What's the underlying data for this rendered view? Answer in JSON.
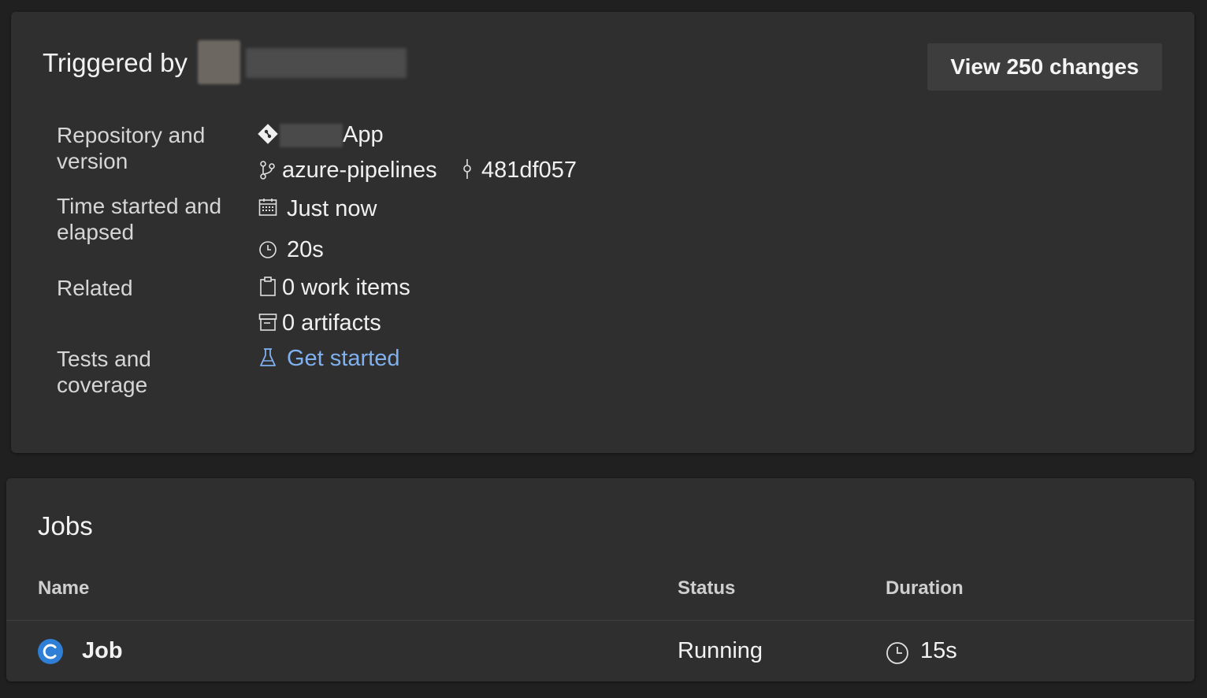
{
  "summary": {
    "triggered_by_label": "Triggered by",
    "view_changes_label": "View 250 changes",
    "repository": {
      "label": "Repository and version",
      "repo_name_suffix": "App",
      "branch": "azure-pipelines",
      "commit": "481df057"
    },
    "time": {
      "label": "Time started and elapsed",
      "started": "Just now",
      "elapsed": "20s"
    },
    "related": {
      "label": "Related",
      "work_items": "0 work items",
      "artifacts": "0 artifacts"
    },
    "tests": {
      "label": "Tests and coverage",
      "link": "Get started"
    }
  },
  "jobs": {
    "title": "Jobs",
    "columns": [
      "Name",
      "Status",
      "Duration"
    ],
    "rows": [
      {
        "name": "Job",
        "status": "Running",
        "duration": "15s"
      }
    ]
  },
  "icons": {
    "repo": "git-repo-icon",
    "branch": "branch-icon",
    "commit": "commit-icon",
    "calendar": "calendar-icon",
    "clock": "clock-icon",
    "work_items": "clipboard-icon",
    "artifacts": "archive-icon",
    "tests": "flask-icon",
    "running": "running-status-icon"
  },
  "colors": {
    "page_background": "#202020",
    "card_background": "#2f2f2f",
    "link": "#7fb0ef",
    "running_status": "#2f7fd6"
  }
}
